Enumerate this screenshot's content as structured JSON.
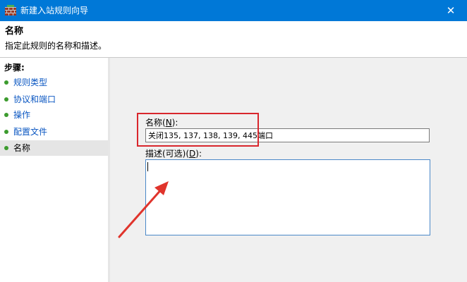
{
  "window": {
    "title": "新建入站规则向导",
    "close_glyph": "✕",
    "app_icon": "firewall-wall-icon"
  },
  "header": {
    "title": "名称",
    "description": "指定此规则的名称和描述。"
  },
  "sidebar": {
    "steps_label": "步骤:",
    "items": [
      {
        "label": "规则类型"
      },
      {
        "label": "协议和端口"
      },
      {
        "label": "操作"
      },
      {
        "label": "配置文件"
      },
      {
        "label": "名称"
      }
    ]
  },
  "form": {
    "name_label_prefix": "名称(",
    "name_label_mnemonic": "N",
    "name_label_suffix": "):",
    "name_value": "关闭135, 137, 138, 139, 445端口",
    "desc_label_prefix": "描述(可选)(",
    "desc_label_mnemonic": "D",
    "desc_label_suffix": "):",
    "desc_value": ""
  },
  "colors": {
    "titlebar": "#0078d7",
    "link": "#0b57c2",
    "bullet": "#3c9b2e",
    "annotation": "#d9262c"
  }
}
